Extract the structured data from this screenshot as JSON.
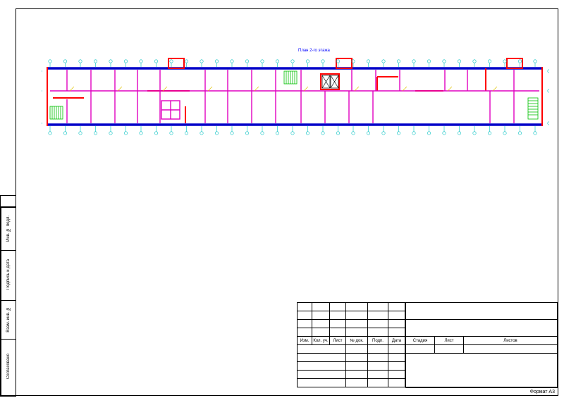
{
  "drawing": {
    "title": "План 2-го этажа",
    "format": "Формат А3"
  },
  "sidebar": {
    "inv_podl": "Инв. № подл.",
    "podpis_data": "Подпись и дата",
    "vzam_inv": "Взам. инв. №",
    "soglasovano": "Согласовано"
  },
  "rev_table": {
    "headers": [
      "Изм.",
      "Кол. уч.",
      "Лист",
      "№ док.",
      "Подп.",
      "Дата"
    ]
  },
  "title_block": {
    "stadia": "Стадия",
    "list": "Лист",
    "listov": "Листов"
  }
}
